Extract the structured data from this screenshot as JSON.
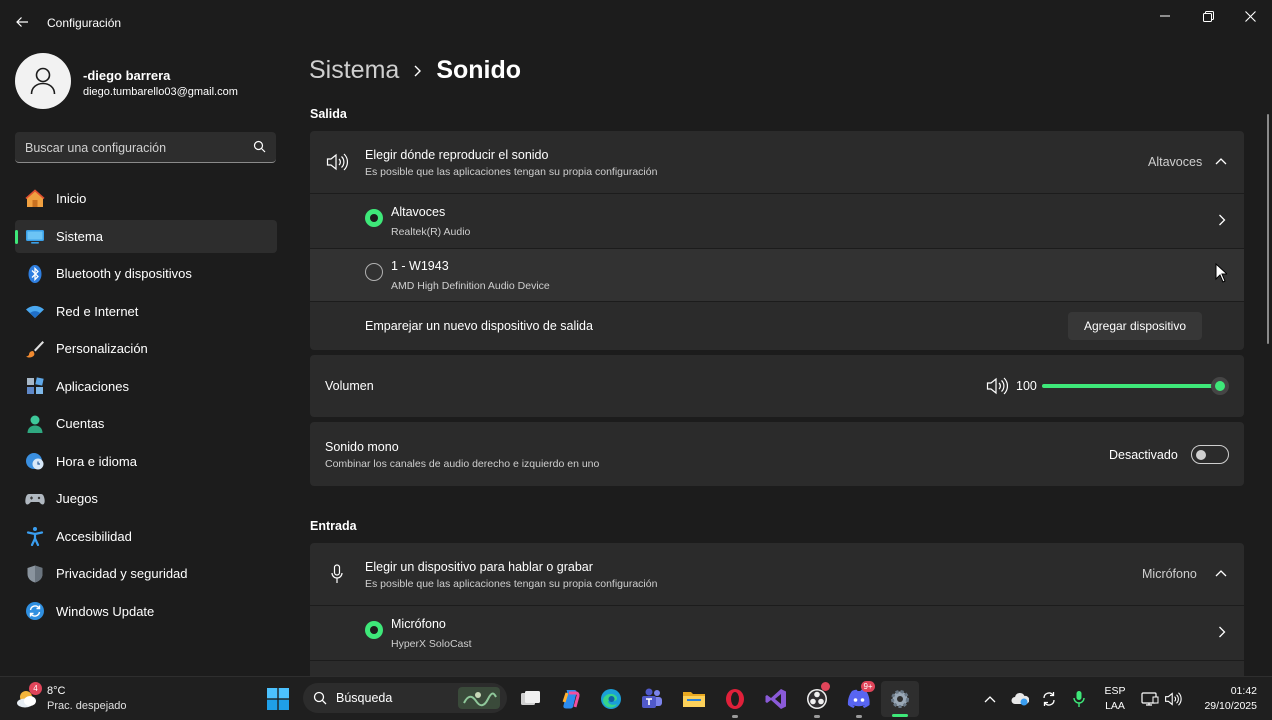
{
  "window": {
    "title": "Configuración",
    "back_icon": "arrow-left-icon",
    "controls": [
      "minimize-icon",
      "restore-icon",
      "close-icon"
    ]
  },
  "user": {
    "name": "-diego barrera",
    "email": "diego.tumbarello03@gmail.com"
  },
  "search": {
    "placeholder": "Buscar una configuración"
  },
  "sidebar": {
    "items": [
      {
        "label": "Inicio",
        "icon": "home-icon"
      },
      {
        "label": "Sistema",
        "icon": "monitor-icon",
        "active": true
      },
      {
        "label": "Bluetooth y dispositivos",
        "icon": "bluetooth-icon"
      },
      {
        "label": "Red e Internet",
        "icon": "wifi-icon"
      },
      {
        "label": "Personalización",
        "icon": "brush-icon"
      },
      {
        "label": "Aplicaciones",
        "icon": "apps-icon"
      },
      {
        "label": "Cuentas",
        "icon": "person-icon"
      },
      {
        "label": "Hora e idioma",
        "icon": "clock-globe-icon"
      },
      {
        "label": "Juegos",
        "icon": "gamepad-icon"
      },
      {
        "label": "Accesibilidad",
        "icon": "accessibility-icon"
      },
      {
        "label": "Privacidad y seguridad",
        "icon": "shield-icon"
      },
      {
        "label": "Windows Update",
        "icon": "update-icon"
      }
    ]
  },
  "breadcrumb": {
    "parent": "Sistema",
    "current": "Sonido"
  },
  "output": {
    "section_title": "Salida",
    "chooser": {
      "title": "Elegir dónde reproducir el sonido",
      "subtitle": "Es posible que las aplicaciones tengan su propia configuración",
      "selected": "Altavoces"
    },
    "devices": [
      {
        "name": "Altavoces",
        "detail": "Realtek(R) Audio",
        "selected": true
      },
      {
        "name": "1 - W1943",
        "detail": "AMD High Definition Audio Device",
        "selected": false
      }
    ],
    "pair": {
      "label": "Emparejar un nuevo dispositivo de salida",
      "button": "Agregar dispositivo"
    },
    "volume": {
      "label": "Volumen",
      "value": "100",
      "level_percent": 100
    },
    "mono": {
      "title": "Sonido mono",
      "subtitle": "Combinar los canales de audio derecho e izquierdo en uno",
      "state_label": "Desactivado",
      "enabled": false
    }
  },
  "input": {
    "section_title": "Entrada",
    "chooser": {
      "title": "Elegir un dispositivo para hablar o grabar",
      "subtitle": "Es posible que las aplicaciones tengan su propia configuración",
      "selected": "Micrófono"
    },
    "devices": [
      {
        "name": "Micrófono",
        "detail": "HyperX SoloCast",
        "selected": true
      }
    ]
  },
  "taskbar": {
    "weather": {
      "temp": "8°C",
      "desc": "Prac. despejado",
      "badge": "4"
    },
    "search_label": "Búsqueda",
    "apps": [
      "windows-start-icon",
      "search-icon",
      "task-view-icon",
      "copilot-icon",
      "edge-icon",
      "teams-icon",
      "file-explorer-icon",
      "opera-icon",
      "visual-studio-icon",
      "obs-icon",
      "discord-icon",
      "settings-icon"
    ],
    "discord_badge": "9+",
    "tray": {
      "lang_top": "ESP",
      "lang_bottom": "LAA",
      "time": "01:42",
      "date": "29/10/2025"
    },
    "accent": "#3ee879"
  }
}
